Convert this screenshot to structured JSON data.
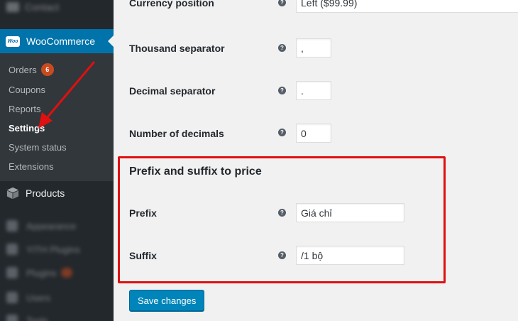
{
  "sidebar": {
    "contact_label": "Contact",
    "woocommerce_label": "WooCommerce",
    "woo_logo_text": "Woo",
    "submenu": [
      {
        "label": "Orders",
        "badge": "6"
      },
      {
        "label": "Coupons"
      },
      {
        "label": "Reports"
      },
      {
        "label": "Settings",
        "current": true
      },
      {
        "label": "System status"
      },
      {
        "label": "Extensions"
      }
    ],
    "products_label": "Products",
    "blurred_items": [
      {
        "label": "Appearance"
      },
      {
        "label": "YITH Plugins"
      },
      {
        "label": "Plugins"
      },
      {
        "label": "Users"
      },
      {
        "label": "Tools"
      }
    ]
  },
  "settings": {
    "currency_position": {
      "label": "Currency position",
      "value": "Left ($99.99)"
    },
    "thousand_separator": {
      "label": "Thousand separator",
      "value": ","
    },
    "decimal_separator": {
      "label": "Decimal separator",
      "value": "."
    },
    "number_of_decimals": {
      "label": "Number of decimals",
      "value": "0"
    },
    "help_glyph": "?"
  },
  "price_section": {
    "title": "Prefix and suffix to price",
    "prefix": {
      "label": "Prefix",
      "value": "Giá chỉ"
    },
    "suffix": {
      "label": "Suffix",
      "value": "/1 bộ"
    }
  },
  "actions": {
    "save_label": "Save changes"
  },
  "colors": {
    "sidebar_bg": "#23282d",
    "submenu_bg": "#32373c",
    "active_menu": "#0073aa",
    "button_primary": "#0085ba",
    "annotation_red": "#e01010",
    "badge": "#ca4a1f"
  }
}
